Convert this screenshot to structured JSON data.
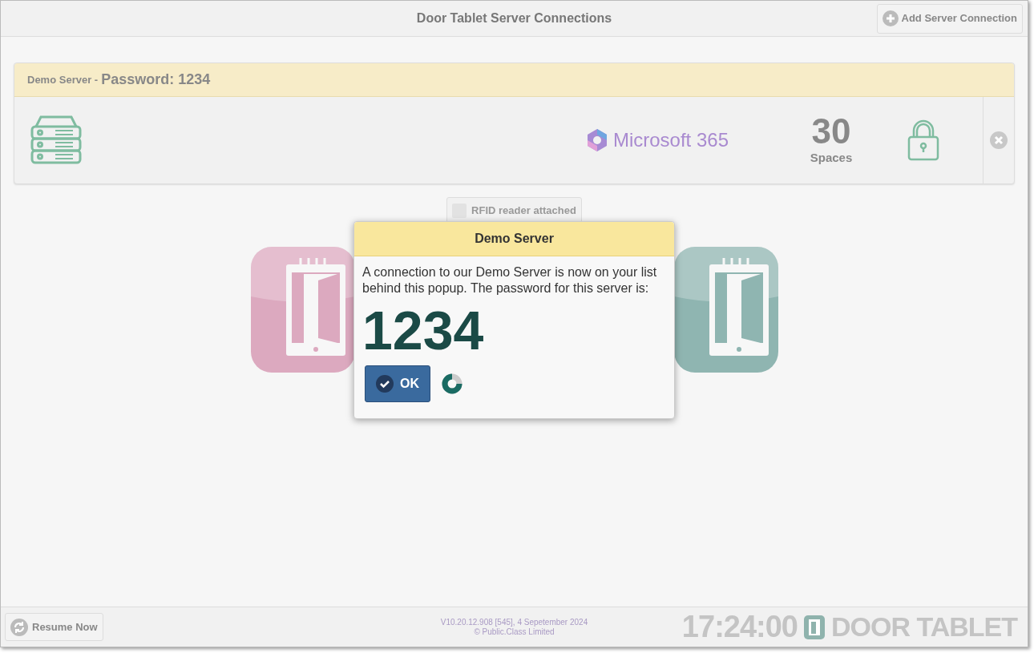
{
  "header": {
    "title": "Door Tablet Server Connections",
    "add_button": "Add Server Connection"
  },
  "servers": [
    {
      "name": "Demo Server -",
      "password": "Password: 1234",
      "provider": "Microsoft 365",
      "count": "30",
      "count_label": "Spaces"
    }
  ],
  "rfid": {
    "label": "RFID reader attached",
    "checked": false
  },
  "dialog": {
    "title": "Demo Server",
    "message": "A connection to our Demo Server is now on your list behind this popup. The password for this server is:",
    "code": "1234",
    "ok": "OK"
  },
  "footer": {
    "resume": "Resume Now",
    "version": "V10.20.12.908 [545], 4 Sepetember 2024",
    "copyright": "© Public.Class Limited",
    "time": "17:24:00",
    "logo": "DOOR TABLET"
  }
}
